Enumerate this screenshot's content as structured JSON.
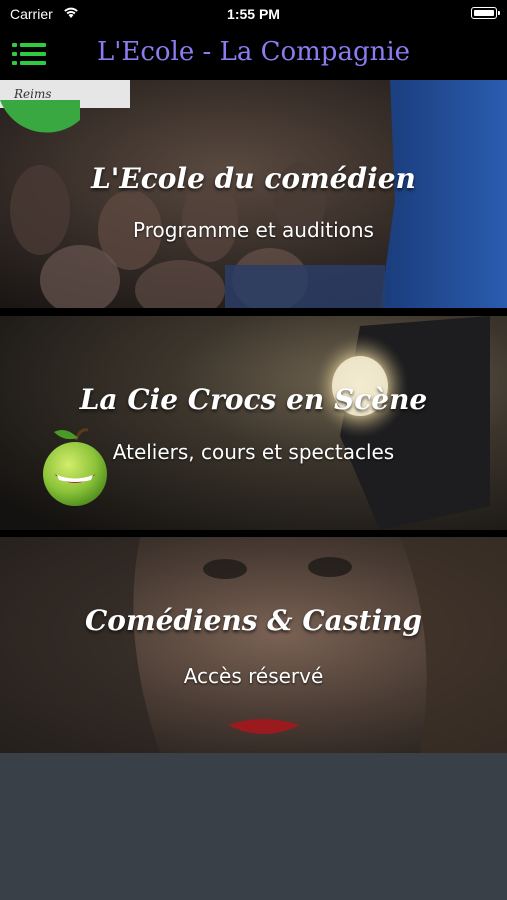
{
  "status_bar": {
    "carrier": "Carrier",
    "time": "1:55 PM"
  },
  "nav": {
    "title": "L'Ecole - La Compagnie",
    "menu_icon": "hamburger-menu-icon"
  },
  "cards": [
    {
      "title": "L'Ecole du comédien",
      "subtitle": "Programme et auditions",
      "logo_text": "Reims"
    },
    {
      "title": "La Cie Crocs en Scène",
      "subtitle": "Ateliers, cours et spectacles",
      "icon": "apple-logo-icon"
    },
    {
      "title": "Comédiens & Casting",
      "subtitle": "Accès réservé"
    }
  ],
  "colors": {
    "accent": "#8b7cf0",
    "menu_icon": "#2ecc40",
    "footer": "#3a4048"
  }
}
